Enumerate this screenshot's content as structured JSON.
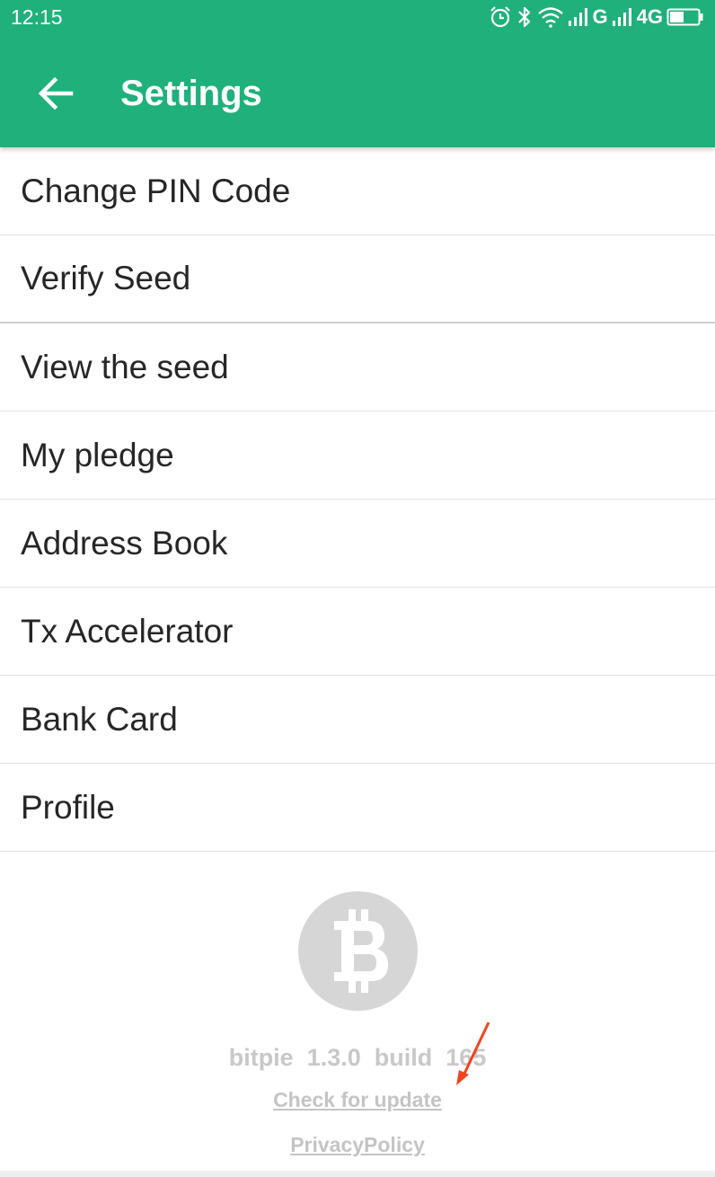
{
  "status_bar": {
    "time": "12:15",
    "icons": [
      "alarm-icon",
      "bluetooth-icon",
      "wifi-icon",
      "signal-icon",
      "signal-icon",
      "battery-icon"
    ],
    "network1": "G",
    "network2": "4G"
  },
  "header": {
    "back_icon": "arrow-left-icon",
    "title": "Settings",
    "color": "#20b07b"
  },
  "menu": {
    "items": [
      {
        "label": "Change PIN Code"
      },
      {
        "label": "Verify Seed"
      },
      {
        "label": "View the seed"
      },
      {
        "label": "My pledge"
      },
      {
        "label": "Address Book"
      },
      {
        "label": "Tx Accelerator"
      },
      {
        "label": "Bank Card"
      },
      {
        "label": "Profile"
      }
    ]
  },
  "footer": {
    "logo_icon": "bitcoin-icon",
    "version": "bitpie  1.3.0  build  165",
    "check_update": "Check for update",
    "privacy_policy": "PrivacyPolicy"
  },
  "annotation": {
    "arrow_color": "#f0431f"
  }
}
